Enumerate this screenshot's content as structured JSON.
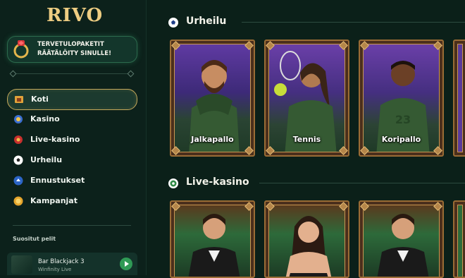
{
  "brand": {
    "logo_text": "RIVO"
  },
  "promo": {
    "text": "TERVETULOPAKETIT RÄÄTÄLÖITY SINULLE!"
  },
  "sidebar": {
    "items": [
      {
        "label": "Koti",
        "icon": "home-icon",
        "active": true
      },
      {
        "label": "Kasino",
        "icon": "casino-icon"
      },
      {
        "label": "Live-kasino",
        "icon": "live-casino-icon"
      },
      {
        "label": "Urheilu",
        "icon": "soccer-ball-icon"
      },
      {
        "label": "Ennustukset",
        "icon": "predictions-icon"
      },
      {
        "label": "Kampanjat",
        "icon": "coin-icon"
      }
    ],
    "popular_title": "Suositut pelit",
    "popular_game": {
      "name": "Bar Blackjack 3",
      "provider": "Winfinity Live"
    }
  },
  "sections": {
    "sports": {
      "title": "Urheilu",
      "cards": [
        {
          "label": "Jalkapallo"
        },
        {
          "label": "Tennis"
        },
        {
          "label": "Koripallo"
        }
      ]
    },
    "live": {
      "title": "Live-kasino"
    }
  },
  "colors": {
    "accent_gold": "#c5a85a",
    "card_purple": "#5a3a9a",
    "card_green": "#2d5a3a",
    "play_green": "#2f9a55"
  }
}
